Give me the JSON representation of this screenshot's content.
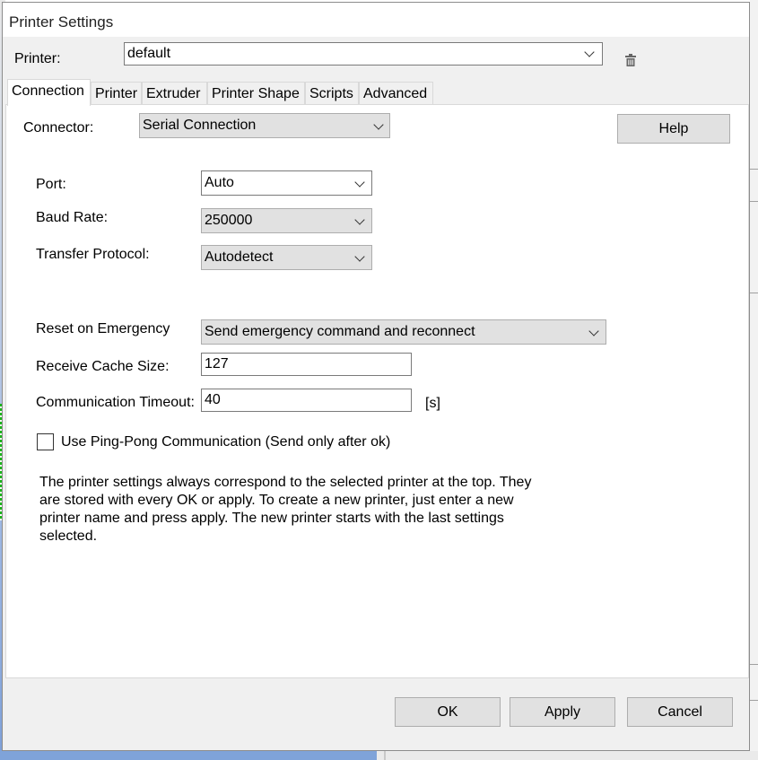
{
  "window": {
    "title": "Printer Settings"
  },
  "printer": {
    "label": "Printer:",
    "value": "default"
  },
  "tabs": [
    {
      "label": "Connection",
      "active": true
    },
    {
      "label": "Printer"
    },
    {
      "label": "Extruder"
    },
    {
      "label": "Printer Shape"
    },
    {
      "label": "Scripts"
    },
    {
      "label": "Advanced"
    }
  ],
  "connection": {
    "connector_label": "Connector:",
    "connector_value": "Serial Connection",
    "help_label": "Help",
    "port_label": "Port:",
    "port_value": "Auto",
    "baud_label": "Baud Rate:",
    "baud_value": "250000",
    "protocol_label": "Transfer Protocol:",
    "protocol_value": "Autodetect",
    "reset_label": "Reset on Emergency",
    "reset_value": "Send emergency command and reconnect",
    "cache_label": "Receive Cache Size:",
    "cache_value": "127",
    "timeout_label": "Communication Timeout:",
    "timeout_value": "40",
    "timeout_unit": "[s]",
    "pingpong_label": "Use Ping-Pong Communication (Send only after ok)",
    "pingpong_checked": false,
    "info_text": "The printer settings always correspond to the selected printer at the top. They are stored with every OK or apply. To create a new printer, just enter a new printer name and press apply. The new printer starts with the last settings selected."
  },
  "footer": {
    "ok_label": "OK",
    "apply_label": "Apply",
    "cancel_label": "Cancel"
  },
  "icons": {
    "trash": "trash-icon",
    "dropdown": "chevron-down-icon"
  }
}
